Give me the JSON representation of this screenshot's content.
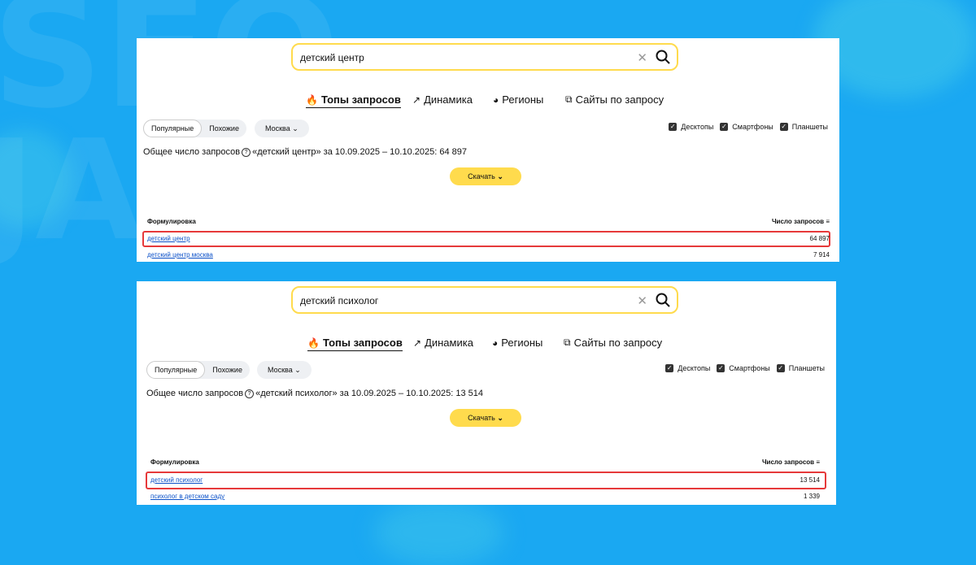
{
  "colors": {
    "background": "#1aa8f2",
    "accent": "#ffdb4d",
    "link": "#0b50c8",
    "highlight": "#e6393a"
  },
  "background_text": {
    "top": "SEO",
    "left": "JA"
  },
  "panels": [
    {
      "search": {
        "value": "детский центр",
        "clear_icon": "close-icon",
        "search_icon": "search-icon"
      },
      "tabs": [
        {
          "label": "Топы запросов",
          "icon": "flame-icon"
        },
        {
          "label": "Динамика",
          "icon": "trend-icon"
        },
        {
          "label": "Регионы",
          "icon": "globe-icon"
        },
        {
          "label": "Сайты по запросу",
          "icon": "external-link-icon"
        }
      ],
      "filter": {
        "popular": "Популярные",
        "similar": "Похожие",
        "region": "Москва"
      },
      "devices": [
        "Десктопы",
        "Смартфоны",
        "Планшеты"
      ],
      "total": {
        "prefix": "Общее число запросов",
        "suffix": "«детский центр» за 10.09.2025 – 10.10.2025: 64 897"
      },
      "download": "Скачать",
      "table": {
        "col_phrase": "Формулировка",
        "col_count": "Число запросов",
        "rows": [
          {
            "phrase": "детский центр",
            "count": "64 897"
          },
          {
            "phrase": "детский центр москва",
            "count": "7 914"
          }
        ]
      }
    },
    {
      "search": {
        "value": "детский психолог",
        "clear_icon": "close-icon",
        "search_icon": "search-icon"
      },
      "tabs": [
        {
          "label": "Топы запросов",
          "icon": "flame-icon"
        },
        {
          "label": "Динамика",
          "icon": "trend-icon"
        },
        {
          "label": "Регионы",
          "icon": "globe-icon"
        },
        {
          "label": "Сайты по запросу",
          "icon": "external-link-icon"
        }
      ],
      "filter": {
        "popular": "Популярные",
        "similar": "Похожие",
        "region": "Москва"
      },
      "devices": [
        "Десктопы",
        "Смартфоны",
        "Планшеты"
      ],
      "total": {
        "prefix": "Общее число запросов",
        "suffix": "«детский психолог» за 10.09.2025 – 10.10.2025: 13 514"
      },
      "download": "Скачать",
      "table": {
        "col_phrase": "Формулировка",
        "col_count": "Число запросов",
        "rows": [
          {
            "phrase": "детский психолог",
            "count": "13 514"
          },
          {
            "phrase": "психолог в детском саду",
            "count": "1 339"
          }
        ]
      }
    }
  ]
}
